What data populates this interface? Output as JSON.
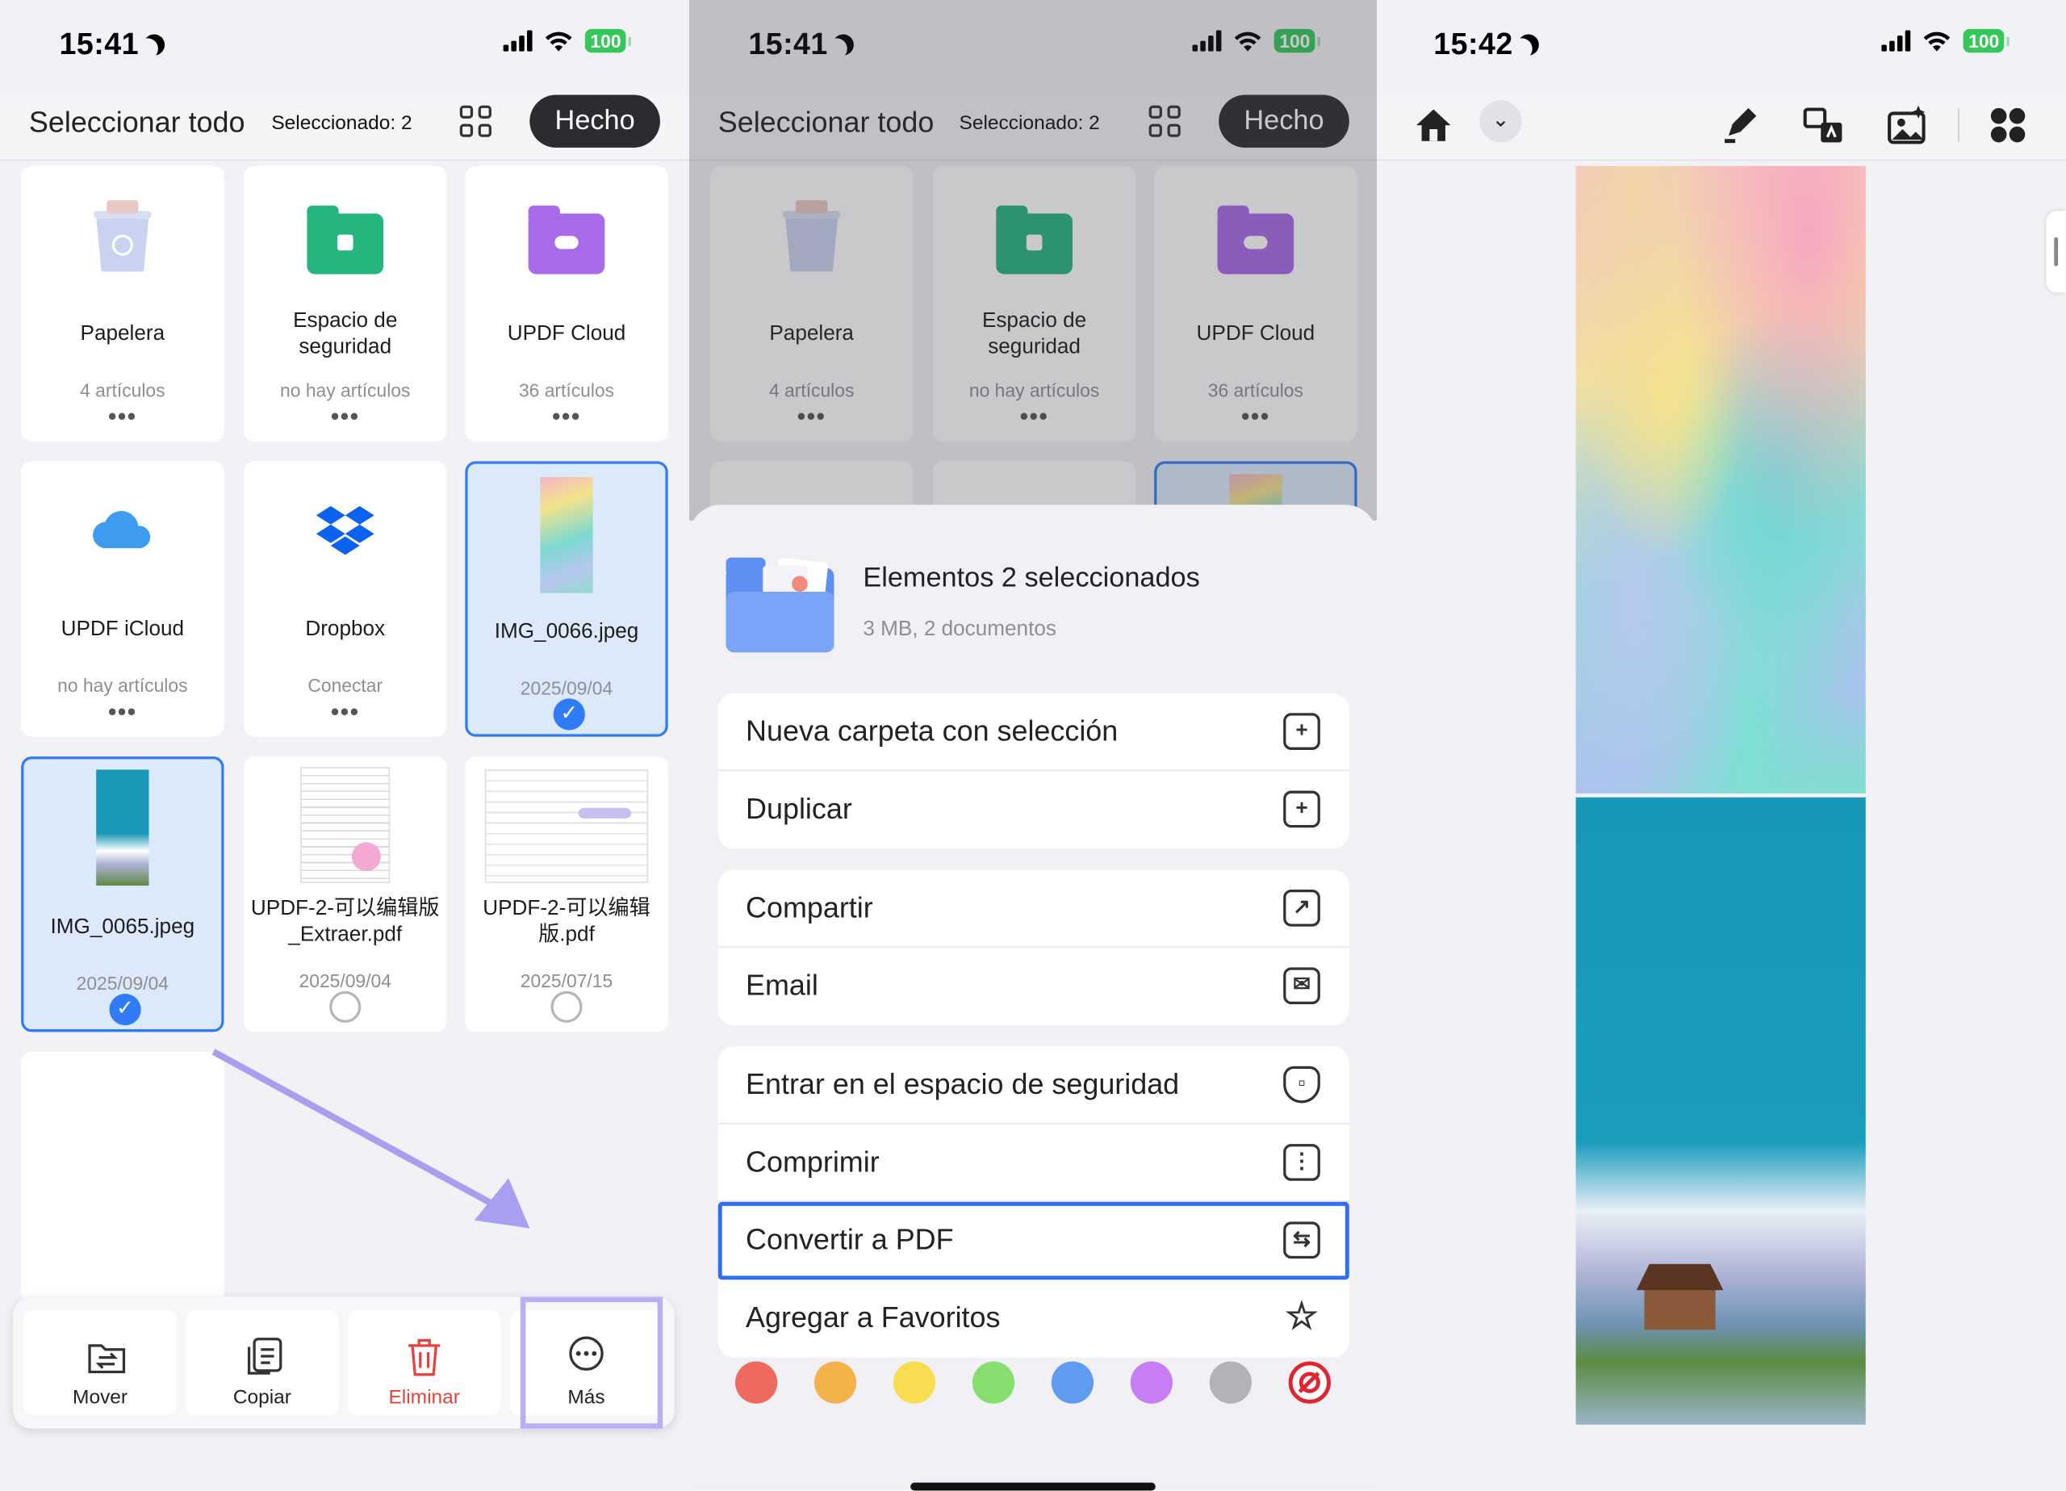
{
  "panel1": {
    "status": {
      "time": "15:41",
      "battery": "100"
    },
    "toolbar": {
      "select_all": "Seleccionar todo",
      "selected": "Seleccionado: 2",
      "done": "Hecho"
    },
    "cards": [
      {
        "name": "Papelera",
        "sub": "4 artículos",
        "more": "•••"
      },
      {
        "name": "Espacio de seguridad",
        "sub": "no hay artículos",
        "more": "•••"
      },
      {
        "name": "UPDF Cloud",
        "sub": "36 artículos",
        "more": "•••"
      },
      {
        "name": "UPDF iCloud",
        "sub": "no hay artículos",
        "more": "•••"
      },
      {
        "name": "Dropbox",
        "sub": "Conectar",
        "more": "•••"
      },
      {
        "name": "IMG_0066.jpeg",
        "sub": "2025/09/04",
        "checked": "✓"
      },
      {
        "name": "IMG_0065.jpeg",
        "sub": "2025/09/04",
        "checked": "✓"
      },
      {
        "name": "UPDF-2-可以编辑版_Extraer.pdf",
        "sub": "2025/09/04"
      },
      {
        "name": "UPDF-2-可以编辑版.pdf",
        "sub": "2025/07/15"
      }
    ],
    "actions": [
      {
        "label": "Mover",
        "icon": "move-folder-icon"
      },
      {
        "label": "Copiar",
        "icon": "copy-icon"
      },
      {
        "label": "Eliminar",
        "icon": "trash-icon",
        "color": "#e8403a"
      },
      {
        "label": "Más",
        "icon": "more-circle-icon"
      }
    ],
    "accent": "#2f7cf6",
    "highlight": "#b7b0f5"
  },
  "panel2": {
    "status": {
      "time": "15:41",
      "battery": "100"
    },
    "toolbar": {
      "select_all": "Seleccionar todo",
      "selected": "Seleccionado: 2",
      "done": "Hecho"
    },
    "cards": [
      {
        "name": "Papelera",
        "sub": "4 artículos",
        "more": "•••"
      },
      {
        "name": "Espacio de seguridad",
        "sub": "no hay artículos",
        "more": "•••"
      },
      {
        "name": "UPDF Cloud",
        "sub": "36 artículos",
        "more": "•••"
      }
    ],
    "sheet": {
      "title": "Elementos 2 seleccionados",
      "subtitle": "3 MB, 2 documentos",
      "group1": [
        "Nueva carpeta con selección",
        "Duplicar"
      ],
      "group2": [
        "Compartir",
        "Email"
      ],
      "group3": [
        "Entrar en el espacio de seguridad",
        "Comprimir",
        "Convertir a PDF",
        "Agregar a Favoritos"
      ],
      "tag_colors": [
        "#ef6a5e",
        "#f4b24a",
        "#f7dd4f",
        "#86df6f",
        "#5f9cf1",
        "#c67ef2",
        "#b2b2b7",
        "#e02530"
      ]
    }
  },
  "panel3": {
    "status": {
      "time": "15:42",
      "battery": "100"
    }
  }
}
